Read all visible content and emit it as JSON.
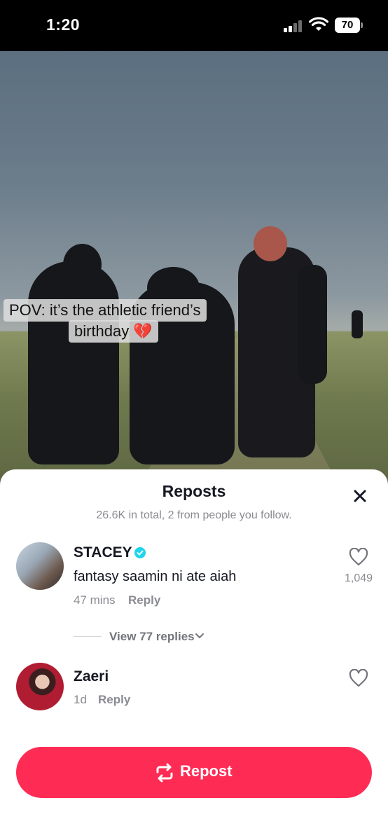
{
  "status_bar": {
    "time": "1:20",
    "battery": "70"
  },
  "video": {
    "caption_line1": "POV: it’s the athletic friend’s",
    "caption_line2": "birthday 💔"
  },
  "sheet": {
    "title": "Reposts",
    "subtitle": "26.6K in total, 2 from people you follow."
  },
  "comments": [
    {
      "username": "STACEY",
      "verified": true,
      "text": "fantasy saamin ni ate aiah",
      "time": "47 mins",
      "reply_label": "Reply",
      "likes": "1,049",
      "view_replies": "View 77 replies"
    },
    {
      "username": "Zaeri",
      "verified": false,
      "text": "",
      "time": "1d",
      "reply_label": "Reply",
      "likes": ""
    }
  ],
  "repost_button": {
    "label": "Repost"
  },
  "colors": {
    "accent": "#fe2c55",
    "verified": "#20d5ec",
    "muted_text": "#8a8b91"
  },
  "icons": [
    "signal-icon",
    "wifi-icon",
    "battery-icon",
    "close-icon",
    "verified-icon",
    "heart-icon",
    "chevron-down-icon",
    "repost-icon"
  ]
}
